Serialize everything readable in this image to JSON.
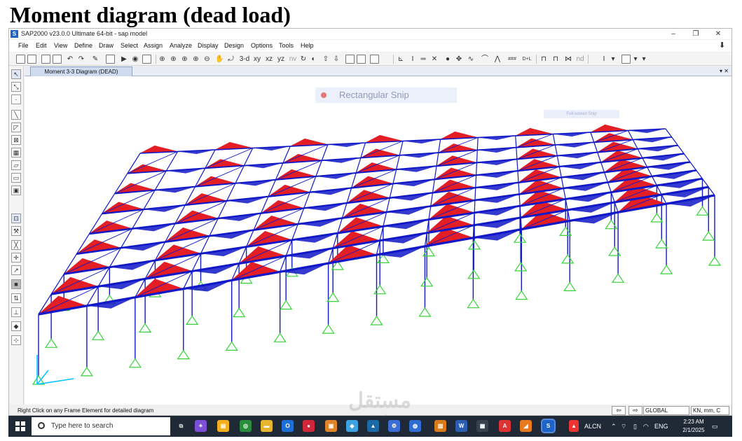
{
  "heading": "Moment diagram (dead load)",
  "window": {
    "app_icon": "S",
    "title": "SAP2000 v23.0.0 Ultimate 64-bit - sap model",
    "controls": {
      "minimize": "–",
      "maximize": "❐",
      "close": "✕"
    }
  },
  "menu": [
    "File",
    "Edit",
    "View",
    "Define",
    "Draw",
    "Select",
    "Assign",
    "Analyze",
    "Display",
    "Design",
    "Options",
    "Tools",
    "Help"
  ],
  "toolbar": {
    "view_3d": "3-d",
    "view_xy": "xy",
    "view_xz": "xz",
    "view_yz": "yz",
    "view_nv": "nv",
    "nd_label": "nd"
  },
  "tab": {
    "label": "Moment 3-3 Diagram (DEAD)",
    "controls": "▾ ✕"
  },
  "overlay": {
    "snip_label": "Rectangular Snip",
    "fullscreen_hint": "Full-screen Snip"
  },
  "statusbar": {
    "hint": "Right Click on any Frame Element for detailed diagram",
    "coord_system": "GLOBAL",
    "units": "KN, mm, C"
  },
  "taskbar": {
    "search_placeholder": "Type here to search",
    "weather": "ALCN",
    "language": "ENG",
    "time": "2:23 AM",
    "date": "2/1/2025"
  },
  "watermark": {
    "arabic": "مستقل",
    "latin": "mostaql.com"
  },
  "colors": {
    "moment_fill": "#e31e24",
    "frame": "#1018c8",
    "support": "#37d437",
    "taskbar": "#202a36"
  }
}
